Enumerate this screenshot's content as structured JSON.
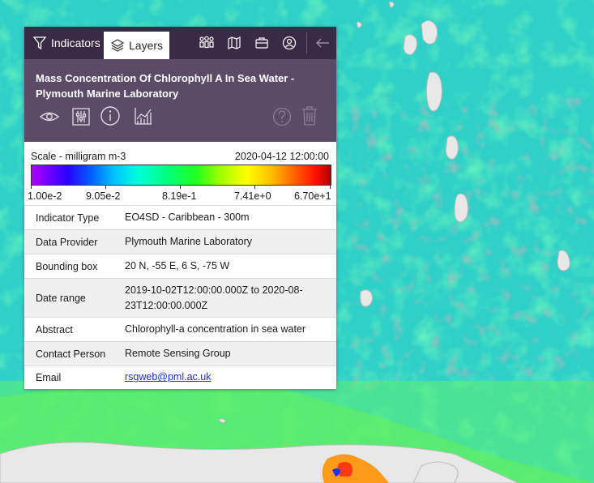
{
  "tabs": [
    {
      "label": "Indicators",
      "icon": "filter-icon"
    },
    {
      "label": "Layers",
      "icon": "layers-icon"
    }
  ],
  "toolbar_icons": [
    "people-icon",
    "map-icon",
    "briefcase-icon",
    "user-icon",
    "collapse-icon"
  ],
  "layer": {
    "title": "Mass Concentration Of Chlorophyll A In Sea Water - Plymouth Marine Laboratory",
    "tools": [
      "eye-icon",
      "sliders-icon",
      "info-icon",
      "chart-icon"
    ],
    "right_tools": [
      "help-icon",
      "trash-icon"
    ]
  },
  "scale": {
    "label": "Scale - milligram m-3",
    "date": "2020-04-12 12:00:00",
    "ticks": [
      "1.00e-2",
      "9.05e-2",
      "8.19e-1",
      "7.41e+0",
      "6.70e+1"
    ]
  },
  "details": [
    {
      "key": "Indicator Type",
      "value": "EO4SD - Caribbean - 300m"
    },
    {
      "key": "Data Provider",
      "value": "Plymouth Marine Laboratory"
    },
    {
      "key": "Bounding box",
      "value": "20 N, -55 E, 6 S, -75 W"
    },
    {
      "key": "Date range",
      "value": "2019-10-02T12:00:00.000Z to 2020-08-23T12:00:00.000Z"
    },
    {
      "key": "Abstract",
      "value": "Chlorophyll-a concentration in sea water"
    },
    {
      "key": "Contact Person",
      "value": "Remote Sensing Group"
    },
    {
      "key": "Email",
      "value": "rsgweb@pml.ac.uk"
    }
  ],
  "colors": {
    "topbar": "#3b2a45",
    "header": "#5b4b66",
    "ocean_cyan": "#2fd0c8",
    "ocean_green": "#4ff27a",
    "link": "#1a2fd6"
  }
}
